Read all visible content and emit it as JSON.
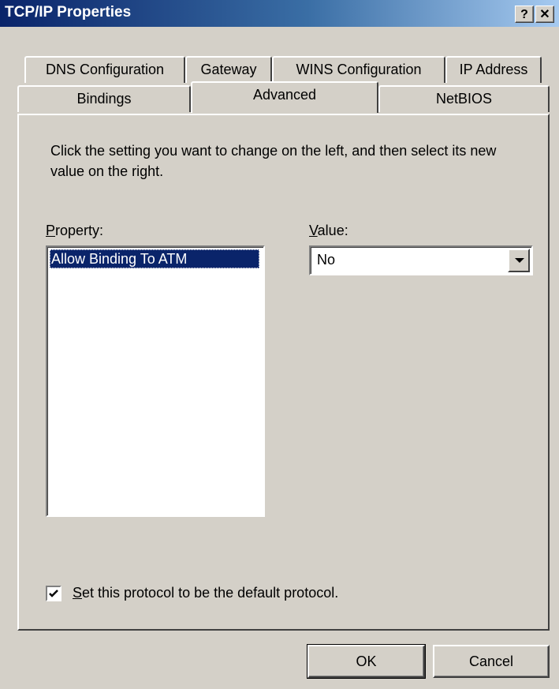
{
  "window": {
    "title": "TCP/IP Properties",
    "help_button": "?",
    "close_button": "✕"
  },
  "tabs": {
    "back_row": [
      "DNS Configuration",
      "Gateway",
      "WINS Configuration",
      "IP Address"
    ],
    "front_row": [
      "Bindings",
      "Advanced",
      "NetBIOS"
    ],
    "active": "Advanced"
  },
  "advanced": {
    "description": "Click the setting you want to change on the left, and then select its new value on the right.",
    "property_label_mnemonic": "P",
    "property_label_rest": "roperty:",
    "value_label_mnemonic": "V",
    "value_label_rest": "alue:",
    "properties": [
      "Allow Binding To ATM"
    ],
    "selected_property": "Allow Binding To ATM",
    "value": "No",
    "default_protocol": {
      "checked": true,
      "label_mnemonic": "S",
      "label_rest": "et this protocol to be the default protocol."
    }
  },
  "buttons": {
    "ok": "OK",
    "cancel": "Cancel"
  },
  "colors": {
    "titlebar_start": "#0a246a",
    "titlebar_end": "#a6caf0",
    "face": "#d4d0c8",
    "selection": "#0a246a"
  }
}
